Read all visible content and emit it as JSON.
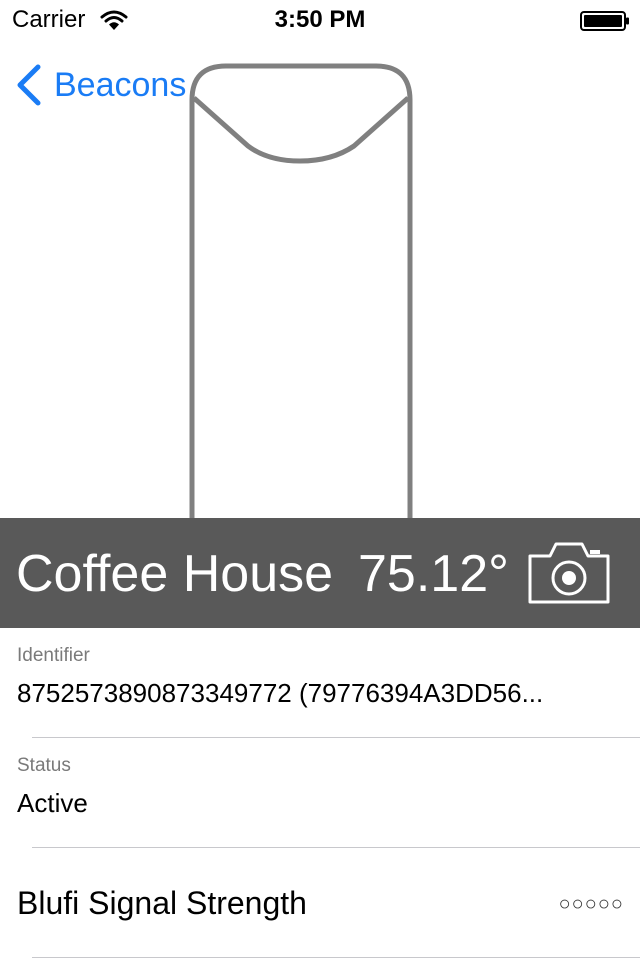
{
  "status_bar": {
    "carrier": "Carrier",
    "time": "3:50 PM",
    "icons": [
      "wifi-icon",
      "battery-icon"
    ]
  },
  "nav": {
    "back_label": "Beacons",
    "back_icon": "chevron-left-icon",
    "accent_color": "#1a7cf5"
  },
  "header": {
    "name": "Coffee House",
    "temperature": "75.12°",
    "camera_icon": "camera-icon",
    "background_color": "#595959"
  },
  "details": {
    "identifier_label": "Identifier",
    "identifier_value": "8752573890873349772 (79776394A3DD56...",
    "status_label": "Status",
    "status_value": "Active",
    "signal_label": "Blufi Signal Strength",
    "signal_dots": "○○○○○",
    "signal_level": 0
  }
}
